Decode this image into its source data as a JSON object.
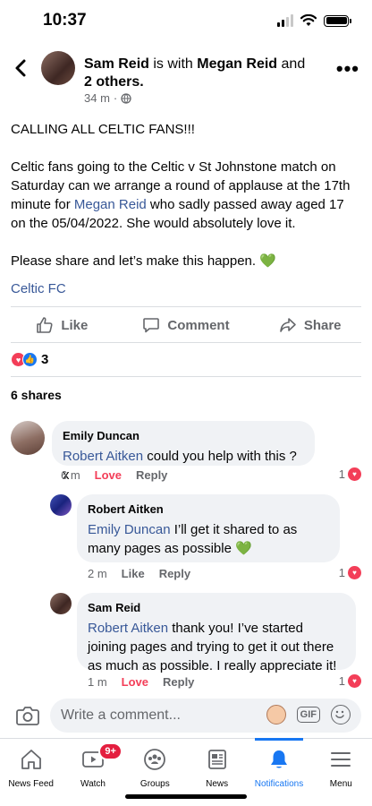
{
  "status": {
    "time": "10:37"
  },
  "post": {
    "author": "Sam Reid",
    "with_text": "is with",
    "tagged": "Megan Reid",
    "and_text": "and",
    "others": "2 others.",
    "meta_time": "34 m",
    "meta_dot": "·",
    "body_line1": "CALLING ALL CELTIC FANS!!!",
    "body_part1": "Celtic fans going to the Celtic v St Johnstone match on Saturday can we arrange a round of applause at the 17th minute for ",
    "body_mention": "Megan Reid",
    "body_part2": " who sadly passed away aged 17 on the 05/04/2022. She would absolutely love it.",
    "body_line3": "Please share and let’s make this happen. 💚",
    "page_link": "Celtic FC",
    "reaction_count": "3",
    "shares": "6 shares"
  },
  "actions": {
    "like": "Like",
    "comment": "Comment",
    "share": "Share"
  },
  "comments": [
    {
      "name": "Emily Duncan",
      "mention": "Robert Aitken",
      "text": " could you help with this ? x",
      "time": "6 m",
      "love": "Love",
      "reply": "Reply",
      "count": "1"
    },
    {
      "name": "Robert Aitken",
      "mention": "Emily Duncan",
      "text": " I’ll get it shared to as many pages as possible 💚",
      "time": "2 m",
      "like": "Like",
      "reply": "Reply",
      "count": "1"
    },
    {
      "name": "Sam Reid",
      "mention": "Robert Aitken",
      "text": " thank you! I’ve started joining pages and trying to get it out there as much as possible. I really appreciate it!",
      "time": "1 m",
      "love": "Love",
      "reply": "Reply",
      "count": "1"
    }
  ],
  "composer": {
    "placeholder": "Write a comment...",
    "gif": "GIF"
  },
  "tabs": [
    {
      "label": "News Feed",
      "icon": "home-icon"
    },
    {
      "label": "Watch",
      "icon": "watch-icon",
      "badge": "9+"
    },
    {
      "label": "Groups",
      "icon": "groups-icon"
    },
    {
      "label": "News",
      "icon": "news-icon"
    },
    {
      "label": "Notifications",
      "icon": "bell-icon",
      "active": true
    },
    {
      "label": "Menu",
      "icon": "menu-icon"
    }
  ],
  "colors": {
    "link": "#385898",
    "love": "#f33e58",
    "fb_blue": "#1877f2",
    "bubble": "#f0f2f5"
  }
}
